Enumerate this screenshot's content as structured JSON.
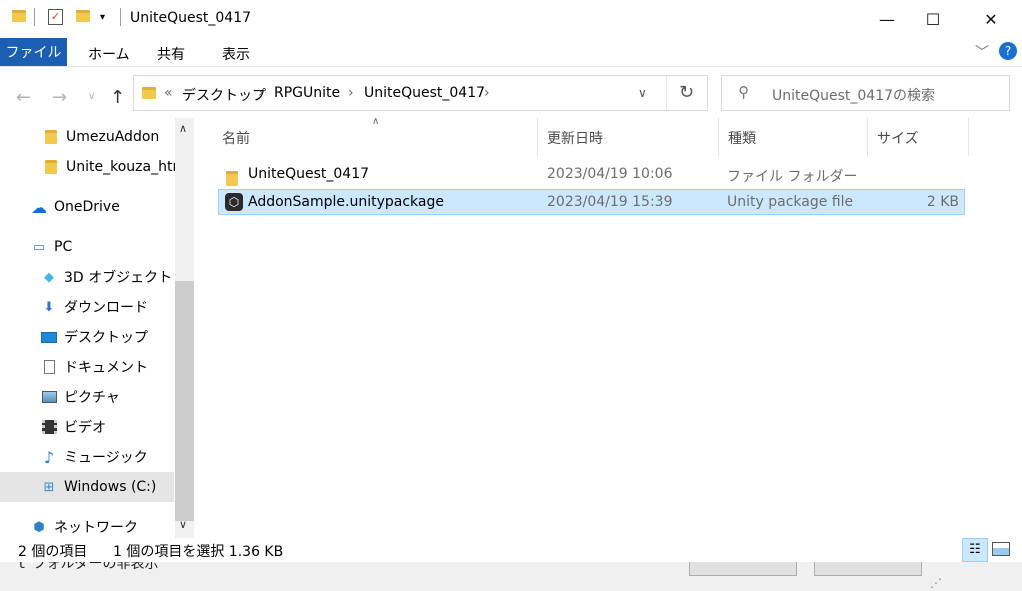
{
  "window": {
    "title": "UniteQuest_0417",
    "minimize": "—",
    "maximize": "☐",
    "close": "✕"
  },
  "ribbon": {
    "tabs": [
      "ファイル",
      "ホーム",
      "共有",
      "表示"
    ],
    "help": "?"
  },
  "address": {
    "overflow": "«",
    "crumbs": [
      "デスクトップ",
      "RPGUnite",
      "UniteQuest_0417"
    ],
    "search_placeholder": "UniteQuest_0417の検索"
  },
  "nav": {
    "items": [
      {
        "label": "UmezuAddon",
        "icon": "folder-icon"
      },
      {
        "label": "Unite_kouza_htm",
        "icon": "folder-icon"
      },
      {
        "label": "OneDrive",
        "icon": "cloud-icon"
      },
      {
        "label": "PC",
        "icon": "pc-icon"
      },
      {
        "label": "3D オブジェクト",
        "icon": "cube-icon"
      },
      {
        "label": "ダウンロード",
        "icon": "download-icon"
      },
      {
        "label": "デスクトップ",
        "icon": "desktop-icon"
      },
      {
        "label": "ドキュメント",
        "icon": "document-icon"
      },
      {
        "label": "ピクチャ",
        "icon": "picture-icon"
      },
      {
        "label": "ビデオ",
        "icon": "video-icon"
      },
      {
        "label": "ミュージック",
        "icon": "music-icon"
      },
      {
        "label": "Windows (C:)",
        "icon": "drive-icon"
      },
      {
        "label": "ネットワーク",
        "icon": "network-icon"
      }
    ]
  },
  "columns": {
    "name": "名前",
    "date": "更新日時",
    "type": "種類",
    "size": "サイズ"
  },
  "files": [
    {
      "name": "UniteQuest_0417",
      "date": "2023/04/19 10:06",
      "type": "ファイル フォルダー",
      "size": ""
    },
    {
      "name": "AddonSample.unitypackage",
      "date": "2023/04/19 15:39",
      "type": "Unity package file",
      "size": "2 KB"
    }
  ],
  "status": {
    "items": "2 個の項目",
    "selected": "1 個の項目を選択 1.36 KB"
  },
  "bottom": {
    "left_text": "ｌ フォルダーの非表示"
  }
}
